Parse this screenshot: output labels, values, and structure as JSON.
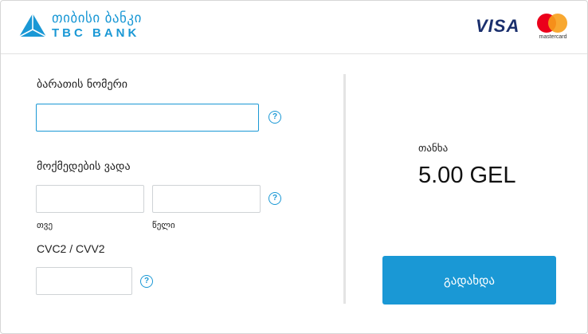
{
  "brand": {
    "name_geo": "თიბისი ბანკი",
    "name_lat": "TBC BANK",
    "primary_color": "#1a98d5"
  },
  "card_logos": {
    "visa": "VISA",
    "mastercard": "mastercard"
  },
  "form": {
    "card_number_label": "ბარათის ნომერი",
    "card_number_value": "",
    "expiry_label": "მოქმედების ვადა",
    "month_label": "თვე",
    "month_value": "",
    "year_label": "წელი",
    "year_value": "",
    "cvc_label": "CVC2 / CVV2",
    "cvc_value": "",
    "help_glyph": "?"
  },
  "summary": {
    "amount_label": "თანხა",
    "amount_value": "5.00 GEL",
    "pay_button_label": "გადახდა"
  },
  "icons": [
    "tbc-logo-icon",
    "help-icon"
  ]
}
